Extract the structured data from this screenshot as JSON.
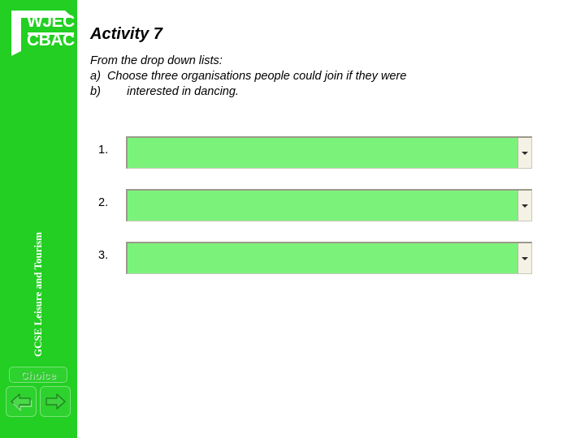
{
  "sidebar": {
    "background_color": "#22cf22",
    "logo": {
      "line1": "WJEC",
      "line2": "CBAC"
    },
    "course_title": "GCSE Leisure and Tourism",
    "choice_button": {
      "label": "Choice"
    },
    "nav": {
      "back_label": "Back",
      "next_label": "Next"
    }
  },
  "main": {
    "title": "Activity 7",
    "instructions": [
      "From the drop down lists:",
      "a)  Choose three organisations people could join if they were",
      "b)        interested in dancing."
    ],
    "dropdowns": [
      {
        "number": "1.",
        "value": "",
        "placeholder": ""
      },
      {
        "number": "2.",
        "value": "",
        "placeholder": ""
      },
      {
        "number": "3.",
        "value": "",
        "placeholder": ""
      }
    ],
    "dropdown_fill_color": "#7bf37b"
  }
}
